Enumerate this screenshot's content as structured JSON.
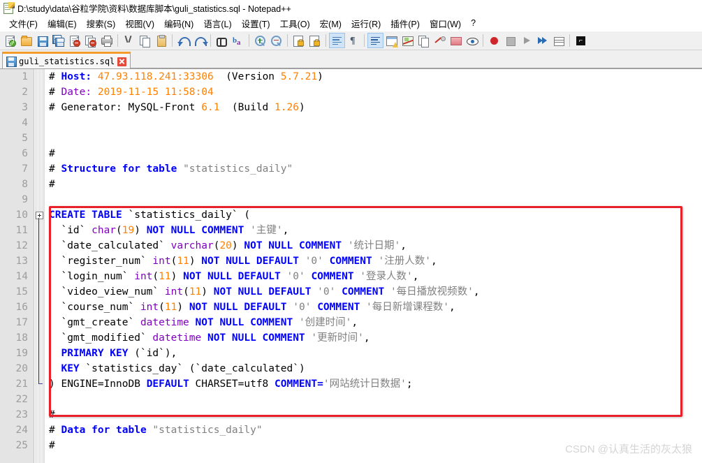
{
  "window": {
    "title": "D:\\study\\data\\谷粒学院\\资料\\数据库脚本\\guli_statistics.sql - Notepad++",
    "icon": "notepad-plus-plus-icon"
  },
  "menu": {
    "items": [
      {
        "label": "文件(F)",
        "name": "menu-file"
      },
      {
        "label": "编辑(E)",
        "name": "menu-edit"
      },
      {
        "label": "搜索(S)",
        "name": "menu-search"
      },
      {
        "label": "视图(V)",
        "name": "menu-view"
      },
      {
        "label": "编码(N)",
        "name": "menu-encoding"
      },
      {
        "label": "语言(L)",
        "name": "menu-language"
      },
      {
        "label": "设置(T)",
        "name": "menu-settings"
      },
      {
        "label": "工具(O)",
        "name": "menu-tools"
      },
      {
        "label": "宏(M)",
        "name": "menu-macro"
      },
      {
        "label": "运行(R)",
        "name": "menu-run"
      },
      {
        "label": "插件(P)",
        "name": "menu-plugins"
      },
      {
        "label": "窗口(W)",
        "name": "menu-window"
      },
      {
        "label": "?",
        "name": "menu-help"
      }
    ]
  },
  "toolbar": {
    "icons": [
      "new-file-icon",
      "open-file-icon",
      "save-icon",
      "save-all-icon",
      "close-file-icon",
      "close-all-icon",
      "print-icon",
      "cut-icon",
      "copy-icon",
      "paste-icon",
      "undo-icon",
      "redo-icon",
      "find-icon",
      "replace-icon",
      "zoom-in-icon",
      "zoom-out-icon",
      "sync-vertical-icon",
      "sync-horizontal-icon",
      "word-wrap-icon",
      "show-all-chars-icon",
      "indent-guide-icon",
      "user-defined-dialog-icon",
      "show-symbol-icon",
      "document-map-icon",
      "function-list-icon",
      "folder-as-workspace-icon",
      "monitoring-icon",
      "record-macro-icon",
      "stop-recording-icon",
      "play-macro-icon",
      "run-macro-multiple-icon",
      "save-macro-icon",
      "run-icon"
    ]
  },
  "tab": {
    "label": "guli_statistics.sql",
    "icon": "saved-floppy-icon",
    "close": "close-tab-icon"
  },
  "editor": {
    "first_line": 1,
    "lines": [
      {
        "n": 1,
        "tokens": [
          {
            "t": "# ",
            "c": "c-def"
          },
          {
            "t": "Host:",
            "c": "c-host"
          },
          {
            "t": " ",
            "c": "c-def"
          },
          {
            "t": "47.93.118.241:33306",
            "c": "c-num"
          },
          {
            "t": "  (Version ",
            "c": "c-def"
          },
          {
            "t": "5.7.21",
            "c": "c-num"
          },
          {
            "t": ")",
            "c": "c-def"
          }
        ]
      },
      {
        "n": 2,
        "tokens": [
          {
            "t": "# ",
            "c": "c-def"
          },
          {
            "t": "Date:",
            "c": "c-date"
          },
          {
            "t": " ",
            "c": "c-def"
          },
          {
            "t": "2019-11-15 11:58:04",
            "c": "c-num"
          }
        ]
      },
      {
        "n": 3,
        "tokens": [
          {
            "t": "# Generator: MySQL-Front ",
            "c": "c-def"
          },
          {
            "t": "6.1",
            "c": "c-num"
          },
          {
            "t": "  (Build ",
            "c": "c-def"
          },
          {
            "t": "1.26",
            "c": "c-num"
          },
          {
            "t": ")",
            "c": "c-def"
          }
        ]
      },
      {
        "n": 4,
        "tokens": []
      },
      {
        "n": 5,
        "tokens": []
      },
      {
        "n": 6,
        "tokens": [
          {
            "t": "#",
            "c": "c-def"
          }
        ]
      },
      {
        "n": 7,
        "tokens": [
          {
            "t": "# ",
            "c": "c-def"
          },
          {
            "t": "Structure for table",
            "c": "c-kw"
          },
          {
            "t": " ",
            "c": "c-def"
          },
          {
            "t": "\"statistics_daily\"",
            "c": "c-str"
          }
        ]
      },
      {
        "n": 8,
        "tokens": [
          {
            "t": "#",
            "c": "c-def"
          }
        ]
      },
      {
        "n": 9,
        "tokens": []
      },
      {
        "n": 10,
        "tokens": [
          {
            "t": "CREATE TABLE",
            "c": "c-kw"
          },
          {
            "t": " `statistics_daily` (",
            "c": "c-id"
          }
        ]
      },
      {
        "n": 11,
        "tokens": [
          {
            "t": "  `id` ",
            "c": "c-id"
          },
          {
            "t": "char",
            "c": "c-type"
          },
          {
            "t": "(",
            "c": "c-id"
          },
          {
            "t": "19",
            "c": "c-num"
          },
          {
            "t": ") ",
            "c": "c-id"
          },
          {
            "t": "NOT NULL COMMENT",
            "c": "c-kw"
          },
          {
            "t": " ",
            "c": "c-id"
          },
          {
            "t": "'主键'",
            "c": "c-str"
          },
          {
            "t": ",",
            "c": "c-id"
          }
        ]
      },
      {
        "n": 12,
        "tokens": [
          {
            "t": "  `date_calculated` ",
            "c": "c-id"
          },
          {
            "t": "varchar",
            "c": "c-type"
          },
          {
            "t": "(",
            "c": "c-id"
          },
          {
            "t": "20",
            "c": "c-num"
          },
          {
            "t": ") ",
            "c": "c-id"
          },
          {
            "t": "NOT NULL COMMENT",
            "c": "c-kw"
          },
          {
            "t": " ",
            "c": "c-id"
          },
          {
            "t": "'统计日期'",
            "c": "c-str"
          },
          {
            "t": ",",
            "c": "c-id"
          }
        ]
      },
      {
        "n": 13,
        "tokens": [
          {
            "t": "  `register_num` ",
            "c": "c-id"
          },
          {
            "t": "int",
            "c": "c-type"
          },
          {
            "t": "(",
            "c": "c-id"
          },
          {
            "t": "11",
            "c": "c-num"
          },
          {
            "t": ") ",
            "c": "c-id"
          },
          {
            "t": "NOT NULL DEFAULT",
            "c": "c-kw"
          },
          {
            "t": " ",
            "c": "c-id"
          },
          {
            "t": "'0'",
            "c": "c-str"
          },
          {
            "t": " ",
            "c": "c-id"
          },
          {
            "t": "COMMENT",
            "c": "c-kw"
          },
          {
            "t": " ",
            "c": "c-id"
          },
          {
            "t": "'注册人数'",
            "c": "c-str"
          },
          {
            "t": ",",
            "c": "c-id"
          }
        ]
      },
      {
        "n": 14,
        "tokens": [
          {
            "t": "  `login_num` ",
            "c": "c-id"
          },
          {
            "t": "int",
            "c": "c-type"
          },
          {
            "t": "(",
            "c": "c-id"
          },
          {
            "t": "11",
            "c": "c-num"
          },
          {
            "t": ") ",
            "c": "c-id"
          },
          {
            "t": "NOT NULL DEFAULT",
            "c": "c-kw"
          },
          {
            "t": " ",
            "c": "c-id"
          },
          {
            "t": "'0'",
            "c": "c-str"
          },
          {
            "t": " ",
            "c": "c-id"
          },
          {
            "t": "COMMENT",
            "c": "c-kw"
          },
          {
            "t": " ",
            "c": "c-id"
          },
          {
            "t": "'登录人数'",
            "c": "c-str"
          },
          {
            "t": ",",
            "c": "c-id"
          }
        ]
      },
      {
        "n": 15,
        "tokens": [
          {
            "t": "  `video_view_num` ",
            "c": "c-id"
          },
          {
            "t": "int",
            "c": "c-type"
          },
          {
            "t": "(",
            "c": "c-id"
          },
          {
            "t": "11",
            "c": "c-num"
          },
          {
            "t": ") ",
            "c": "c-id"
          },
          {
            "t": "NOT NULL DEFAULT",
            "c": "c-kw"
          },
          {
            "t": " ",
            "c": "c-id"
          },
          {
            "t": "'0'",
            "c": "c-str"
          },
          {
            "t": " ",
            "c": "c-id"
          },
          {
            "t": "COMMENT",
            "c": "c-kw"
          },
          {
            "t": " ",
            "c": "c-id"
          },
          {
            "t": "'每日播放视频数'",
            "c": "c-str"
          },
          {
            "t": ",",
            "c": "c-id"
          }
        ]
      },
      {
        "n": 16,
        "tokens": [
          {
            "t": "  `course_num` ",
            "c": "c-id"
          },
          {
            "t": "int",
            "c": "c-type"
          },
          {
            "t": "(",
            "c": "c-id"
          },
          {
            "t": "11",
            "c": "c-num"
          },
          {
            "t": ") ",
            "c": "c-id"
          },
          {
            "t": "NOT NULL DEFAULT",
            "c": "c-kw"
          },
          {
            "t": " ",
            "c": "c-id"
          },
          {
            "t": "'0'",
            "c": "c-str"
          },
          {
            "t": " ",
            "c": "c-id"
          },
          {
            "t": "COMMENT",
            "c": "c-kw"
          },
          {
            "t": " ",
            "c": "c-id"
          },
          {
            "t": "'每日新增课程数'",
            "c": "c-str"
          },
          {
            "t": ",",
            "c": "c-id"
          }
        ]
      },
      {
        "n": 17,
        "tokens": [
          {
            "t": "  `gmt_create` ",
            "c": "c-id"
          },
          {
            "t": "datetime",
            "c": "c-type"
          },
          {
            "t": " ",
            "c": "c-id"
          },
          {
            "t": "NOT NULL COMMENT",
            "c": "c-kw"
          },
          {
            "t": " ",
            "c": "c-id"
          },
          {
            "t": "'创建时间'",
            "c": "c-str"
          },
          {
            "t": ",",
            "c": "c-id"
          }
        ]
      },
      {
        "n": 18,
        "tokens": [
          {
            "t": "  `gmt_modified` ",
            "c": "c-id"
          },
          {
            "t": "datetime",
            "c": "c-type"
          },
          {
            "t": " ",
            "c": "c-id"
          },
          {
            "t": "NOT NULL COMMENT",
            "c": "c-kw"
          },
          {
            "t": " ",
            "c": "c-id"
          },
          {
            "t": "'更新时间'",
            "c": "c-str"
          },
          {
            "t": ",",
            "c": "c-id"
          }
        ]
      },
      {
        "n": 19,
        "tokens": [
          {
            "t": "  ",
            "c": "c-id"
          },
          {
            "t": "PRIMARY KEY",
            "c": "c-kw"
          },
          {
            "t": " (`id`),",
            "c": "c-id"
          }
        ]
      },
      {
        "n": 20,
        "tokens": [
          {
            "t": "  ",
            "c": "c-id"
          },
          {
            "t": "KEY",
            "c": "c-kw"
          },
          {
            "t": " `statistics_day` (`date_calculated`)",
            "c": "c-id"
          }
        ]
      },
      {
        "n": 21,
        "tokens": [
          {
            "t": ") ENGINE=InnoDB ",
            "c": "c-id"
          },
          {
            "t": "DEFAULT",
            "c": "c-kw"
          },
          {
            "t": " CHARSET=utf8 ",
            "c": "c-id"
          },
          {
            "t": "COMMENT=",
            "c": "c-kw"
          },
          {
            "t": "'网站统计日数据'",
            "c": "c-str"
          },
          {
            "t": ";",
            "c": "c-id"
          }
        ]
      },
      {
        "n": 22,
        "tokens": []
      },
      {
        "n": 23,
        "tokens": [
          {
            "t": "#",
            "c": "c-def"
          }
        ]
      },
      {
        "n": 24,
        "tokens": [
          {
            "t": "# ",
            "c": "c-def"
          },
          {
            "t": "Data for table",
            "c": "c-kw"
          },
          {
            "t": " ",
            "c": "c-def"
          },
          {
            "t": "\"statistics_daily\"",
            "c": "c-str"
          }
        ]
      },
      {
        "n": 25,
        "tokens": [
          {
            "t": "#",
            "c": "c-def"
          }
        ]
      }
    ],
    "fold_start_line": 10,
    "fold_end_line": 21
  },
  "annotation": {
    "name": "red-highlight-box",
    "color": "#e8202a",
    "covers_lines": "10-21"
  },
  "watermark": {
    "text": "CSDN @认真生活的灰太狼",
    "color": "#d4d4d4"
  }
}
